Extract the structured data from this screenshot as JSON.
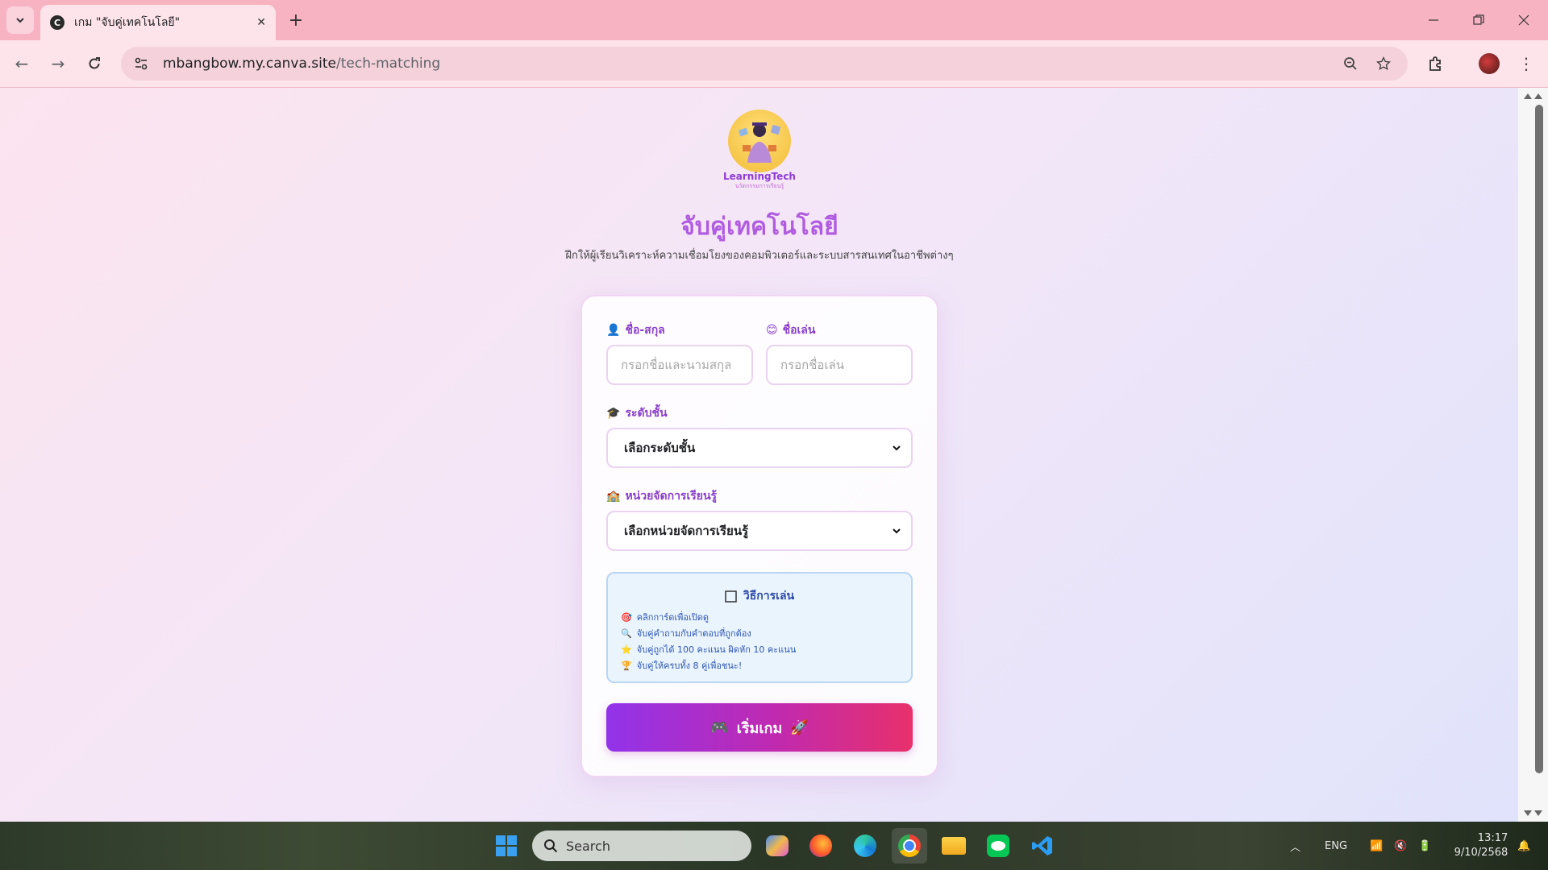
{
  "browser": {
    "tab_title": "เกม \"จับคู่เทคโนโลยี\"",
    "favicon_letter": "C",
    "url_host": "mbangbow.my.canva.site",
    "url_path": "/tech-matching"
  },
  "page": {
    "logo_text": "LearningTech",
    "logo_subtext": "นวัตกรรมการเรียนรู้",
    "title": "จับคู่เทคโนโลยี",
    "subtitle": "ฝึกให้ผู้เรียนวิเคราะห์ความเชื่อมโยงของคอมพิวเตอร์และระบบสารสนเทศในอาชีพต่างๆ",
    "form": {
      "fullname_label": "ชื่อ-สกุล",
      "fullname_placeholder": "กรอกชื่อและนามสกุล",
      "nickname_label": "ชื่อเล่น",
      "nickname_placeholder": "กรอกชื่อเล่น",
      "grade_label": "ระดับชั้น",
      "grade_selected": "เลือกระดับชั้น",
      "unit_label": "หน่วยจัดการเรียนรู้",
      "unit_selected": "เลือกหน่วยจัดการเรียนรู้"
    },
    "howto": {
      "title": "วิธีการเล่น",
      "items": [
        {
          "icon": "🎯",
          "text": "คลิกการ์ดเพื่อเปิดดู"
        },
        {
          "icon": "🔍",
          "text": "จับคู่คำถามกับคำตอบที่ถูกต้อง"
        },
        {
          "icon": "⭐",
          "text": "จับคู่ถูกได้ 100 คะแนน ผิดหัก 10 คะแนน"
        },
        {
          "icon": "🏆",
          "text": "จับคู่ให้ครบทั้ง 8 คู่เพื่อชนะ!"
        }
      ]
    },
    "start_button": "เริ่มเกม"
  },
  "taskbar": {
    "search_label": "Search",
    "language": "ENG",
    "time": "13:17",
    "date": "9/10/2568"
  }
}
